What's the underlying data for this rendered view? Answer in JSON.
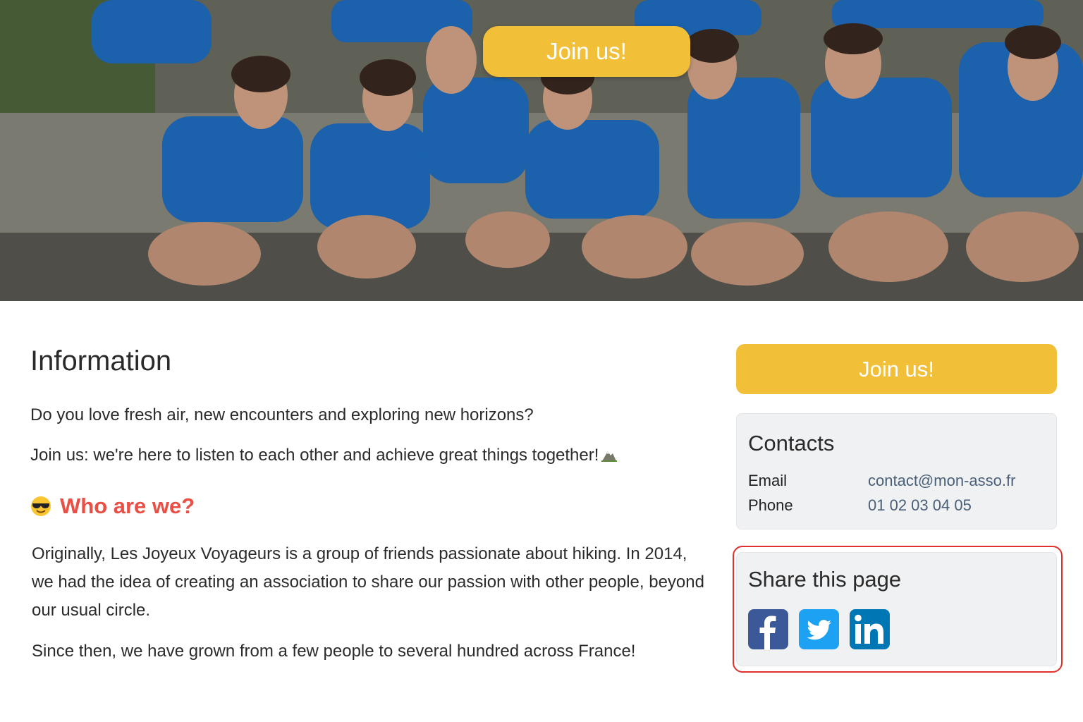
{
  "hero": {
    "join_label": "Join us!"
  },
  "main": {
    "title": "Information",
    "intro": "Do you love fresh air, new encounters and exploring new horizons?",
    "invite": "Join us: we're here to listen to each other and achieve great things together!",
    "who_heading": "Who are we?",
    "who_text": "Originally, Les Joyeux Voyageurs is a group of friends passionate about hiking. In 2014, we had the idea of creating an association to share our passion with other people, beyond our usual circle.",
    "since_text": "Since then, we have grown from a few people to several hundred across France!",
    "emoji": "smiling-face-with-sunglasses-icon",
    "invite_icon": "mountain-icon"
  },
  "sidebar": {
    "join_label": "Join us!",
    "contacts": {
      "title": "Contacts",
      "email_label": "Email",
      "email_value": "contact@mon-asso.fr",
      "phone_label": "Phone",
      "phone_value": "01 02 03 04 05"
    },
    "share": {
      "title": "Share this page",
      "icons": [
        "facebook-icon",
        "twitter-icon",
        "linkedin-icon"
      ]
    }
  },
  "colors": {
    "accent_yellow": "#f2c038",
    "heading_red": "#e94f45",
    "link_blue": "#4a5f78",
    "highlight_red": "#e0322b",
    "facebook": "#3b5998",
    "twitter": "#1da1f2",
    "linkedin": "#0077b5"
  }
}
